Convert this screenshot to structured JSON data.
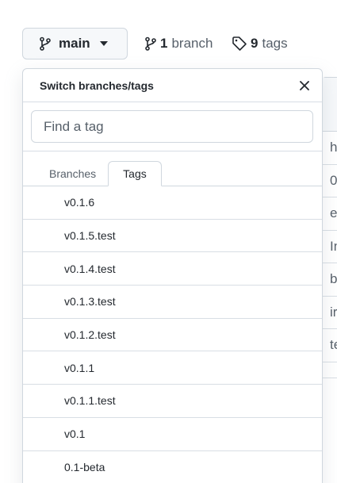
{
  "branch_selector": {
    "current": "main"
  },
  "stats": {
    "branches": {
      "count": "1",
      "word": "branch"
    },
    "tags": {
      "count": "9",
      "word": "tags"
    }
  },
  "dropdown": {
    "title": "Switch branches/tags",
    "filter_placeholder": "Find a tag",
    "tabs": [
      {
        "label": "Branches",
        "selected": false
      },
      {
        "label": "Tags",
        "selected": true
      }
    ],
    "tags": [
      "v0.1.6",
      "v0.1.5.test",
      "v0.1.4.test",
      "v0.1.3.test",
      "v0.1.2.test",
      "v0.1.1",
      "v0.1.1.test",
      "v0.1",
      "0.1-beta"
    ]
  },
  "background_rows": [
    "h",
    "0",
    "e",
    "In",
    "b",
    "ir",
    "te"
  ]
}
